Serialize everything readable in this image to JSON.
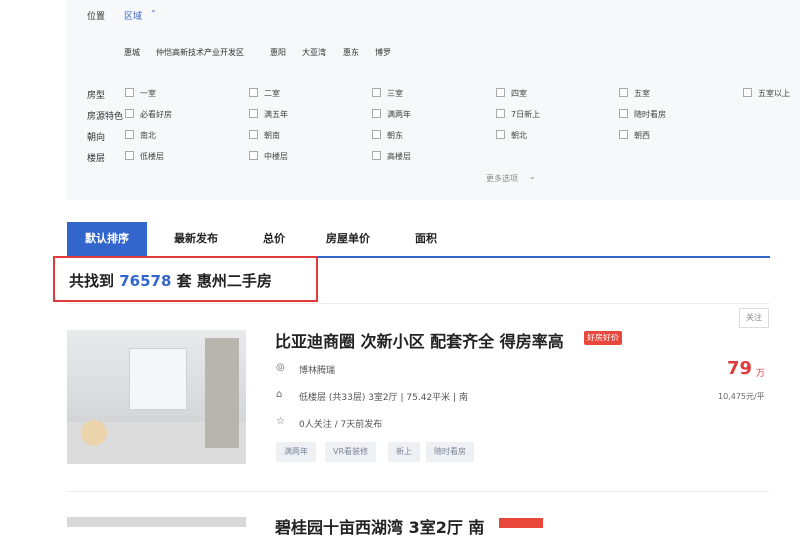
{
  "filters": {
    "location": {
      "label": "位置",
      "mode": "区域"
    },
    "districts": [
      "惠城",
      "仲恺高新技术产业开发区",
      "惠阳",
      "大亚湾",
      "惠东",
      "博罗"
    ],
    "rooms": {
      "label": "房型",
      "options": [
        "一室",
        "二室",
        "三室",
        "四室",
        "五室",
        "五室以上"
      ]
    },
    "features": {
      "label": "房源特色",
      "options": [
        "必看好房",
        "满五年",
        "满两年",
        "7日新上",
        "随时看房"
      ]
    },
    "orientation": {
      "label": "朝向",
      "options": [
        "南北",
        "朝南",
        "朝东",
        "朝北",
        "朝西"
      ]
    },
    "floor": {
      "label": "楼层",
      "options": [
        "低楼层",
        "中楼层",
        "高楼层"
      ]
    },
    "more": "更多选项"
  },
  "sort_tabs": [
    "默认排序",
    "最新发布",
    "总价",
    "房屋单价",
    "面积"
  ],
  "result": {
    "prefix": "共找到",
    "count": "76578",
    "suffix": "套 惠州二手房"
  },
  "listing": {
    "follow": "关注",
    "title": "比亚迪商圈 次新小区 配套齐全 得房率高",
    "badge": "好房好价",
    "community": "博林腾瑞",
    "details": "低楼层 (共33层) 3室2厅 | 75.42平米 | 南",
    "followers": "0人关注 / 7天前发布",
    "tags": [
      "满两年",
      "VR看装修",
      "新上",
      "随时看房"
    ],
    "price": "79",
    "price_unit": "万",
    "unit_price": "10,475元/平"
  },
  "next_listing": {
    "title": "碧桂园十亩西湖湾 3室2厅 南"
  }
}
